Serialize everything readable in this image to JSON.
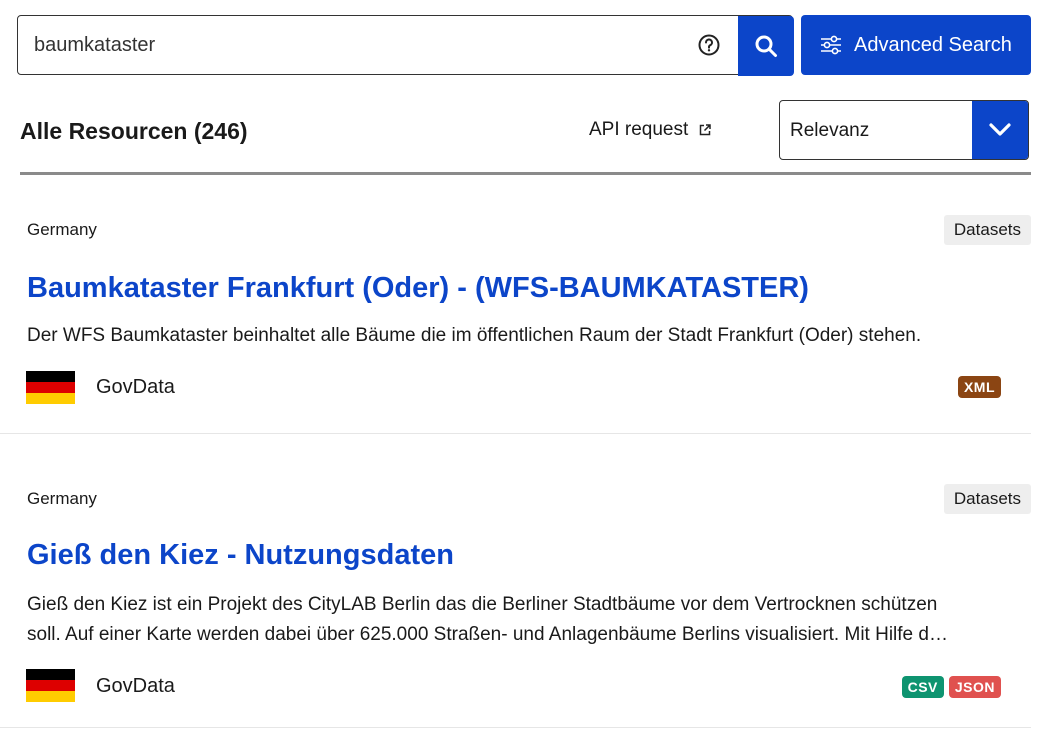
{
  "search": {
    "value": "baumkataster",
    "advanced_label": "Advanced Search"
  },
  "results": {
    "title": "Alle Resourcen (246)",
    "api_label": "API request",
    "sort_value": "Relevanz"
  },
  "cards": [
    {
      "country": "Germany",
      "type": "Datasets",
      "title": "Baumkataster Frankfurt (Oder) - (WFS-BAUMKATASTER)",
      "description": "Der WFS Baumkataster beinhaltet alle Bäume die im öffentlichen Raum der Stadt Frankfurt (Oder) stehen.",
      "publisher": "GovData",
      "formats": [
        {
          "label": "XML",
          "color": "#8b4513"
        }
      ]
    },
    {
      "country": "Germany",
      "type": "Datasets",
      "title": "Gieß den Kiez - Nutzungsdaten",
      "description_line1": "Gieß den Kiez ist ein Projekt des CityLAB Berlin das die Berliner Stadtbäume vor dem Vertrocknen schützen",
      "description_line2": "soll. Auf einer Karte werden dabei über 625.000 Straßen- und Anlagenbäume Berlins visualisiert. Mit Hilfe d…",
      "publisher": "GovData",
      "formats": [
        {
          "label": "CSV",
          "color": "#0e9470"
        },
        {
          "label": "JSON",
          "color": "#e0514f"
        }
      ]
    }
  ],
  "flag_colors": [
    "#000000",
    "#dd0000",
    "#ffcc00"
  ],
  "icons": {
    "help": "help-circle-icon",
    "search": "search-icon",
    "advanced": "sliders-icon",
    "external": "external-link-icon",
    "chevron": "chevron-down-icon"
  }
}
